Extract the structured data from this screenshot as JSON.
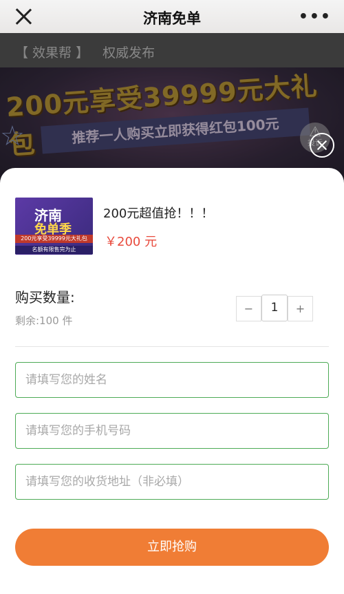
{
  "header": {
    "title": "济南免单",
    "more_icon": "ellipsis-icon"
  },
  "article": {
    "source_tag": "【 效果帮 】",
    "source_label": "权威发布"
  },
  "banner": {
    "headline": "200元享受39999元大礼包",
    "subline": "推荐一人购买立即获得红包100元",
    "report_label": "投诉"
  },
  "product": {
    "thumb_title": "济南",
    "thumb_subtitle": "免单季",
    "thumb_strip": "200元享受39999元大礼包",
    "thumb_footer": "名额有限售完为止",
    "name": "200元超值抢！！！",
    "price": "￥200 元"
  },
  "quantity": {
    "label": "购买数量:",
    "remaining": "剩余:100 件",
    "minus": "−",
    "value": "1",
    "plus": "+"
  },
  "form": {
    "name_placeholder": "请填写您的姓名",
    "phone_placeholder": "请填写您的手机号码",
    "address_placeholder": "请填写您的收货地址（非必填）"
  },
  "actions": {
    "buy_label": "立即抢购"
  },
  "colors": {
    "accent": "#f07d35",
    "price": "#e84a3c",
    "field_border": "#4caa55"
  }
}
